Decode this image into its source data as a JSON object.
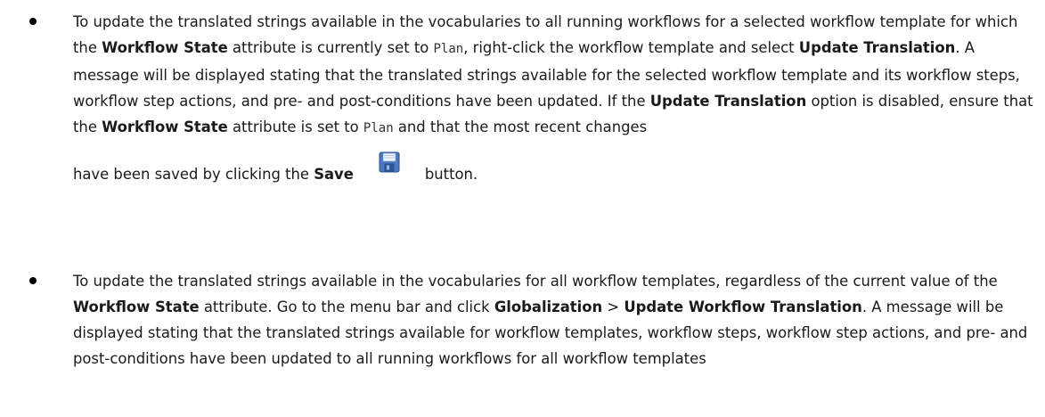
{
  "bullets": [
    {
      "t1": "To update the translated strings available in the vocabularies to all running workflows for a selected workflow template for which the ",
      "b1": "Workflow State",
      "t2": " attribute is currently set to ",
      "c1": "Plan",
      "t3": ", right-click the workflow template and select ",
      "b2": "Update Translation",
      "t4": ". A message will be displayed stating that the translated strings available for the selected workflow template and its workflow steps, workflow step actions, and pre- and post-conditions have been updated. If the ",
      "b3": "Update Translation",
      "t5": " option is disabled, ensure that the ",
      "b4": "Workflow State",
      "t6": " attribute is set to ",
      "c2": "Plan",
      "t7": " and that the most recent changes",
      "t8": "have been saved by clicking the ",
      "b5": "Save",
      "icon": "save-icon",
      "t9": "button."
    },
    {
      "t1": "To update the translated strings available in the vocabularies for all workflow templates, regardless of the current value of the ",
      "b1": "Workflow State",
      "t2": " attribute. Go to the menu bar and click ",
      "b2": "Globalization",
      "t3": " > ",
      "b3": "Update Workflow Translation",
      "t4": ". A message will be displayed stating that the translated strings available for workflow templates, workflow steps, workflow step actions, and pre- and post-conditions have been updated to all running workflows for all workflow templates"
    }
  ]
}
